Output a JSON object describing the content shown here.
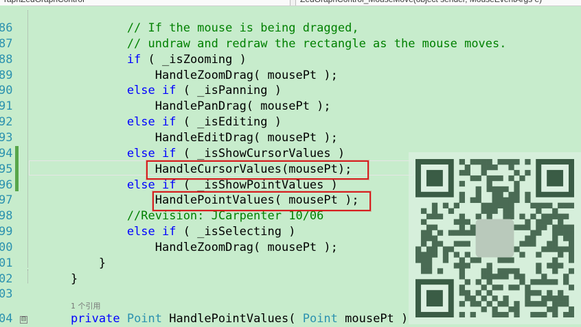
{
  "tabs": {
    "left": "raphZedGraphControl",
    "right": "ZedGraphControl_MouseMove(object sender, MouseEventArgs e)"
  },
  "lines": [
    {
      "n": "86",
      "code": [
        [
          "cm",
          "            // If the mouse is being dragged,"
        ]
      ]
    },
    {
      "n": "87",
      "code": [
        [
          "cm",
          "            // undraw and redraw the rectangle as the mouse moves."
        ]
      ]
    },
    {
      "n": "88",
      "code": [
        [
          "kw",
          "            if"
        ],
        [
          "",
          "( _isZooming )"
        ]
      ]
    },
    {
      "n": "89",
      "code": [
        [
          "",
          "                HandleZoomDrag( mousePt );"
        ]
      ]
    },
    {
      "n": "90",
      "code": [
        [
          "kw",
          "            else if"
        ],
        [
          "",
          "( _isPanning )"
        ]
      ]
    },
    {
      "n": "91",
      "code": [
        [
          "",
          "                HandlePanDrag( mousePt );"
        ]
      ]
    },
    {
      "n": "92",
      "code": [
        [
          "kw",
          "            else if"
        ],
        [
          "",
          "( _isEditing )"
        ]
      ]
    },
    {
      "n": "93",
      "code": [
        [
          "",
          "                HandleEditDrag( mousePt );"
        ]
      ]
    },
    {
      "n": "94",
      "code": [
        [
          "kw",
          "            else if"
        ],
        [
          "",
          "( _isShowCursorValues )"
        ]
      ]
    },
    {
      "n": "95",
      "code": [
        [
          "",
          "                HandleCursorValues(mousePt);"
        ]
      ]
    },
    {
      "n": "96",
      "code": [
        [
          "kw",
          "            else if"
        ],
        [
          "",
          "( _isShowPointValues )"
        ]
      ]
    },
    {
      "n": "97",
      "code": [
        [
          "",
          "                HandlePointValues( mousePt );"
        ]
      ]
    },
    {
      "n": "98",
      "code": [
        [
          "cm",
          "            //Revision: JCarpenter 10/06"
        ]
      ]
    },
    {
      "n": "99",
      "code": [
        [
          "kw",
          "            else if"
        ],
        [
          "",
          "( _isSelecting )"
        ]
      ]
    },
    {
      "n": "00",
      "code": [
        [
          "",
          "                HandleZoomDrag( mousePt );"
        ]
      ]
    },
    {
      "n": "01",
      "code": [
        [
          "",
          "        }"
        ]
      ]
    },
    {
      "n": "02",
      "code": [
        [
          "",
          "    }"
        ]
      ]
    },
    {
      "n": "03",
      "code": [
        [
          "",
          ""
        ]
      ]
    },
    {
      "n": "04",
      "code": [
        [
          "kw",
          "    private "
        ],
        [
          "ty",
          "Point "
        ],
        [
          "",
          "HandlePointValues( "
        ],
        [
          "ty",
          "Point "
        ],
        [
          "",
          "mousePt )"
        ]
      ]
    }
  ],
  "codelens": "1 个引用",
  "fold_symbol": "⊟",
  "colors": {
    "background": "#c7eccc",
    "keyword": "#0000ff",
    "comment": "#008000",
    "type": "#2b91af",
    "highlight": "#d61f1f"
  },
  "qr_code": "watermark-qr"
}
